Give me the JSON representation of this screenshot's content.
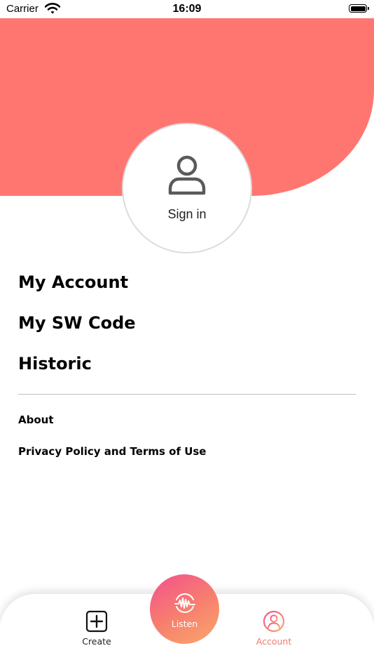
{
  "status_bar": {
    "carrier": "Carrier",
    "time": "16:09"
  },
  "profile": {
    "sign_in_label": "Sign in"
  },
  "menu": {
    "primary": [
      {
        "label": "My Account"
      },
      {
        "label": "My SW Code"
      },
      {
        "label": "Historic"
      }
    ],
    "secondary": [
      {
        "label": "About"
      },
      {
        "label": "Privacy Policy and Terms of Use"
      }
    ]
  },
  "tab_bar": {
    "create_label": "Create",
    "listen_label": "Listen",
    "account_label": "Account",
    "active_tab": "Account"
  },
  "colors": {
    "header": "#ff7671",
    "accent_gradient_start": "#f2508f",
    "accent_gradient_end": "#f9a86a",
    "active_tab": "#f07a6a"
  },
  "icons": {
    "user": "person-outline-icon",
    "create": "plus-square-icon",
    "listen": "soundwave-icon",
    "account": "account-circle-icon",
    "wifi": "wifi-icon",
    "battery": "battery-icon"
  }
}
